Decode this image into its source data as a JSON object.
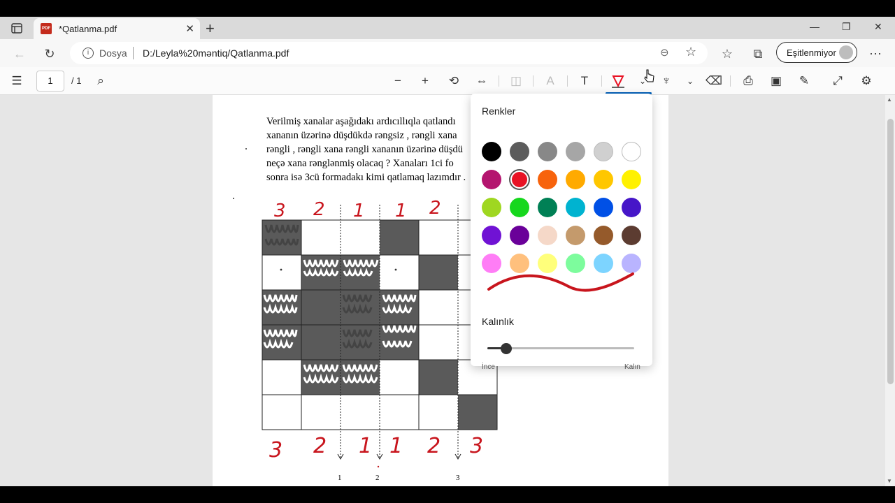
{
  "tab": {
    "title": "*Qatlanma.pdf"
  },
  "address": {
    "scheme_label": "Dosya",
    "url": "D:/Leyla%20məntiq/Qatlanma.pdf"
  },
  "profile": {
    "label": "Eşitlenmiyor"
  },
  "pdf_toolbar": {
    "page_current": "1",
    "page_total": "/ 1"
  },
  "document": {
    "paragraph": [
      "Verilmiş xanalar aşağıdakı ardıcıllıqla qatlandı",
      "xananın üzərinə düşdükdə rəngsiz , rəngli xana",
      "rəngli , rəngli xana rəngli xananın üzərinə düşdü",
      "neçə xana rənglənmiş olacaq ? Xanaları 1ci fo",
      "sonra isə 3cü formadakı kimi qatlamaq lazımdır ."
    ],
    "top_handwritten_labels": [
      "3",
      "2",
      "1",
      "1",
      "2"
    ],
    "bottom_handwritten_labels": [
      "3",
      "2",
      "1",
      "1",
      "2",
      "3"
    ],
    "fold_numbers": [
      "1",
      "2",
      "3"
    ]
  },
  "color_popup": {
    "colors_heading": "Renkler",
    "thickness_heading": "Kalınlık",
    "thin_label": "İnce",
    "thick_label": "Kalın",
    "selected_color": "#e81224",
    "thickness_level": 0.13,
    "colors": [
      [
        "#000000",
        "#5c5c5c",
        "#888888",
        "#a6a6a6",
        "#d0d0d0",
        "#ffffff"
      ],
      [
        "#b4156f",
        "#e81224",
        "#f7630c",
        "#ffaa00",
        "#ffc700",
        "#fff100"
      ],
      [
        "#9fd721",
        "#16d71d",
        "#008055",
        "#00b3d0",
        "#0050e6",
        "#4616c8"
      ],
      [
        "#7012d4",
        "#6a0099",
        "#f5d8c8",
        "#c49a6c",
        "#955a2b",
        "#5c3c31"
      ],
      [
        "#ff7df6",
        "#ffc07d",
        "#ffff7b",
        "#7dfc9d",
        "#7dd4ff",
        "#b9b4ff"
      ]
    ]
  }
}
